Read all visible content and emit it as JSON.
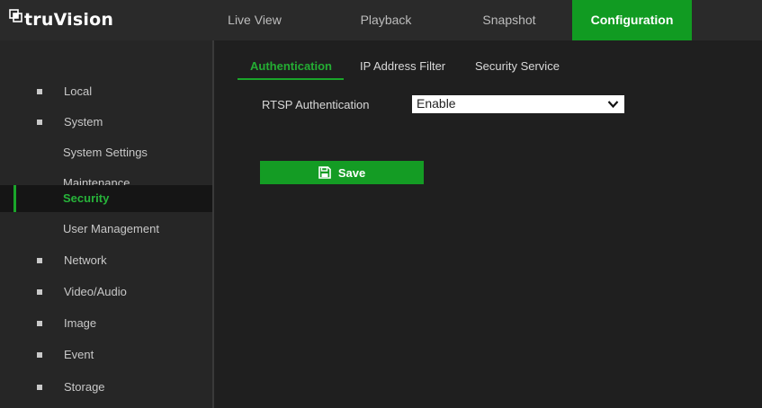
{
  "header": {
    "brand": "truVision",
    "nav": [
      {
        "label": "Live View",
        "active": false
      },
      {
        "label": "Playback",
        "active": false
      },
      {
        "label": "Snapshot",
        "active": false
      },
      {
        "label": "Configuration",
        "active": true
      }
    ]
  },
  "sidebar": {
    "items": [
      {
        "label": "Local"
      },
      {
        "label": "System"
      },
      {
        "label": "System Settings"
      },
      {
        "label": "Maintenance"
      },
      {
        "label": "Security",
        "active": true
      },
      {
        "label": "User Management"
      },
      {
        "label": "Network"
      },
      {
        "label": "Video/Audio"
      },
      {
        "label": "Image"
      },
      {
        "label": "Event"
      },
      {
        "label": "Storage"
      }
    ]
  },
  "main": {
    "tabs": [
      {
        "label": "Authentication",
        "active": true
      },
      {
        "label": "IP Address Filter"
      },
      {
        "label": "Security Service"
      }
    ],
    "rtsp": {
      "label": "RTSP Authentication",
      "value": "Enable"
    },
    "save_label": "Save"
  },
  "colors": {
    "accent": "#119b22",
    "background": "#1f1f1f",
    "topbar": "#2a2a2a",
    "sidebar": "#262626"
  },
  "icons": {
    "logo": "truvision-logo-icon",
    "select": "chevron-down-icon",
    "save": "floppy-disk-icon",
    "bullet": "square-bullet-icon"
  }
}
